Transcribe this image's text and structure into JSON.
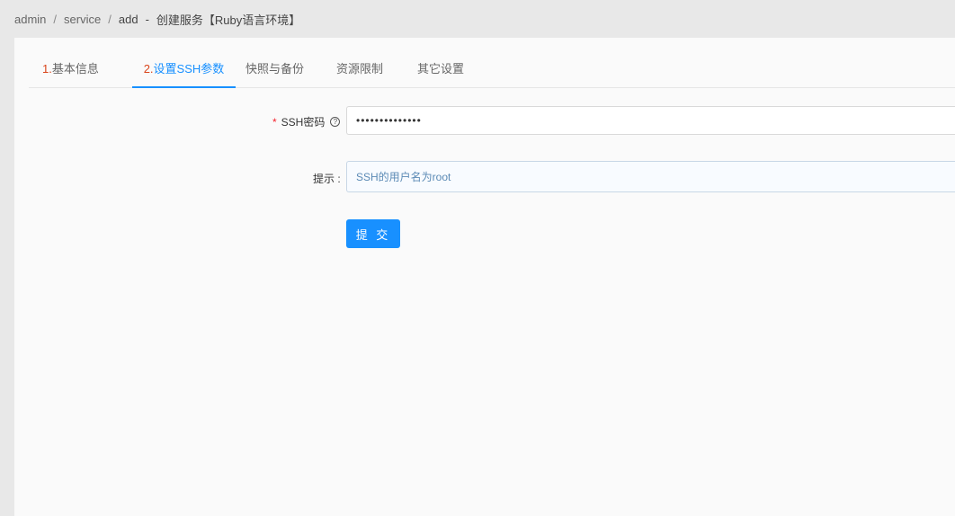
{
  "breadcrumb": {
    "items": [
      "admin",
      "service",
      "add"
    ],
    "separator": "/",
    "dash": "-",
    "title": "创建服务【Ruby语言环境】"
  },
  "tabs": [
    {
      "num": "1.",
      "label": "基本信息",
      "active": false
    },
    {
      "num": "2.",
      "label": "设置SSH参数",
      "active": true
    },
    {
      "num": "",
      "label": "快照与备份",
      "active": false
    },
    {
      "num": "",
      "label": "资源限制",
      "active": false
    },
    {
      "num": "",
      "label": "其它设置",
      "active": false
    }
  ],
  "form": {
    "ssh_password": {
      "required_mark": "*",
      "label": "SSH密码",
      "help": "?",
      "value": "••••••••••••••"
    },
    "hint": {
      "label": "提示 :",
      "value": "SSH的用户名为root"
    },
    "submit_label": "提 交"
  },
  "colors": {
    "accent": "#1890ff",
    "tab_number": "#d9451b",
    "required": "#f5222d"
  }
}
